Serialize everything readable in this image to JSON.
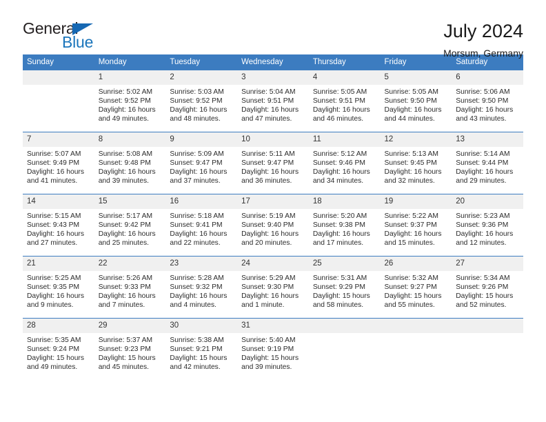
{
  "brand": {
    "name_top": "General",
    "name_bottom": "Blue",
    "accent_color": "#1b75bb",
    "triangle_color": "#1668b3"
  },
  "header": {
    "title": "July 2024",
    "subtitle": "Morsum, Germany"
  },
  "theme": {
    "header_blue": "#3c7cc0",
    "daynum_stripe": "#f0f0f0",
    "text_color": "#2b2b2b"
  },
  "weekdays": [
    "Sunday",
    "Monday",
    "Tuesday",
    "Wednesday",
    "Thursday",
    "Friday",
    "Saturday"
  ],
  "labels": {
    "sunrise_prefix": "Sunrise:",
    "sunset_prefix": "Sunset:",
    "daylight_prefix": "Daylight:"
  },
  "weeks": [
    [
      {
        "day": "",
        "empty": true,
        "l1": "",
        "l2": "",
        "l3": "",
        "l4": ""
      },
      {
        "day": "1",
        "l1": "Sunrise: 5:02 AM",
        "l2": "Sunset: 9:52 PM",
        "l3": "Daylight: 16 hours",
        "l4": "and 49 minutes."
      },
      {
        "day": "2",
        "l1": "Sunrise: 5:03 AM",
        "l2": "Sunset: 9:52 PM",
        "l3": "Daylight: 16 hours",
        "l4": "and 48 minutes."
      },
      {
        "day": "3",
        "l1": "Sunrise: 5:04 AM",
        "l2": "Sunset: 9:51 PM",
        "l3": "Daylight: 16 hours",
        "l4": "and 47 minutes."
      },
      {
        "day": "4",
        "l1": "Sunrise: 5:05 AM",
        "l2": "Sunset: 9:51 PM",
        "l3": "Daylight: 16 hours",
        "l4": "and 46 minutes."
      },
      {
        "day": "5",
        "l1": "Sunrise: 5:05 AM",
        "l2": "Sunset: 9:50 PM",
        "l3": "Daylight: 16 hours",
        "l4": "and 44 minutes."
      },
      {
        "day": "6",
        "l1": "Sunrise: 5:06 AM",
        "l2": "Sunset: 9:50 PM",
        "l3": "Daylight: 16 hours",
        "l4": "and 43 minutes."
      }
    ],
    [
      {
        "day": "7",
        "l1": "Sunrise: 5:07 AM",
        "l2": "Sunset: 9:49 PM",
        "l3": "Daylight: 16 hours",
        "l4": "and 41 minutes."
      },
      {
        "day": "8",
        "l1": "Sunrise: 5:08 AM",
        "l2": "Sunset: 9:48 PM",
        "l3": "Daylight: 16 hours",
        "l4": "and 39 minutes."
      },
      {
        "day": "9",
        "l1": "Sunrise: 5:09 AM",
        "l2": "Sunset: 9:47 PM",
        "l3": "Daylight: 16 hours",
        "l4": "and 37 minutes."
      },
      {
        "day": "10",
        "l1": "Sunrise: 5:11 AM",
        "l2": "Sunset: 9:47 PM",
        "l3": "Daylight: 16 hours",
        "l4": "and 36 minutes."
      },
      {
        "day": "11",
        "l1": "Sunrise: 5:12 AM",
        "l2": "Sunset: 9:46 PM",
        "l3": "Daylight: 16 hours",
        "l4": "and 34 minutes."
      },
      {
        "day": "12",
        "l1": "Sunrise: 5:13 AM",
        "l2": "Sunset: 9:45 PM",
        "l3": "Daylight: 16 hours",
        "l4": "and 32 minutes."
      },
      {
        "day": "13",
        "l1": "Sunrise: 5:14 AM",
        "l2": "Sunset: 9:44 PM",
        "l3": "Daylight: 16 hours",
        "l4": "and 29 minutes."
      }
    ],
    [
      {
        "day": "14",
        "l1": "Sunrise: 5:15 AM",
        "l2": "Sunset: 9:43 PM",
        "l3": "Daylight: 16 hours",
        "l4": "and 27 minutes."
      },
      {
        "day": "15",
        "l1": "Sunrise: 5:17 AM",
        "l2": "Sunset: 9:42 PM",
        "l3": "Daylight: 16 hours",
        "l4": "and 25 minutes."
      },
      {
        "day": "16",
        "l1": "Sunrise: 5:18 AM",
        "l2": "Sunset: 9:41 PM",
        "l3": "Daylight: 16 hours",
        "l4": "and 22 minutes."
      },
      {
        "day": "17",
        "l1": "Sunrise: 5:19 AM",
        "l2": "Sunset: 9:40 PM",
        "l3": "Daylight: 16 hours",
        "l4": "and 20 minutes."
      },
      {
        "day": "18",
        "l1": "Sunrise: 5:20 AM",
        "l2": "Sunset: 9:38 PM",
        "l3": "Daylight: 16 hours",
        "l4": "and 17 minutes."
      },
      {
        "day": "19",
        "l1": "Sunrise: 5:22 AM",
        "l2": "Sunset: 9:37 PM",
        "l3": "Daylight: 16 hours",
        "l4": "and 15 minutes."
      },
      {
        "day": "20",
        "l1": "Sunrise: 5:23 AM",
        "l2": "Sunset: 9:36 PM",
        "l3": "Daylight: 16 hours",
        "l4": "and 12 minutes."
      }
    ],
    [
      {
        "day": "21",
        "l1": "Sunrise: 5:25 AM",
        "l2": "Sunset: 9:35 PM",
        "l3": "Daylight: 16 hours",
        "l4": "and 9 minutes."
      },
      {
        "day": "22",
        "l1": "Sunrise: 5:26 AM",
        "l2": "Sunset: 9:33 PM",
        "l3": "Daylight: 16 hours",
        "l4": "and 7 minutes."
      },
      {
        "day": "23",
        "l1": "Sunrise: 5:28 AM",
        "l2": "Sunset: 9:32 PM",
        "l3": "Daylight: 16 hours",
        "l4": "and 4 minutes."
      },
      {
        "day": "24",
        "l1": "Sunrise: 5:29 AM",
        "l2": "Sunset: 9:30 PM",
        "l3": "Daylight: 16 hours",
        "l4": "and 1 minute."
      },
      {
        "day": "25",
        "l1": "Sunrise: 5:31 AM",
        "l2": "Sunset: 9:29 PM",
        "l3": "Daylight: 15 hours",
        "l4": "and 58 minutes."
      },
      {
        "day": "26",
        "l1": "Sunrise: 5:32 AM",
        "l2": "Sunset: 9:27 PM",
        "l3": "Daylight: 15 hours",
        "l4": "and 55 minutes."
      },
      {
        "day": "27",
        "l1": "Sunrise: 5:34 AM",
        "l2": "Sunset: 9:26 PM",
        "l3": "Daylight: 15 hours",
        "l4": "and 52 minutes."
      }
    ],
    [
      {
        "day": "28",
        "l1": "Sunrise: 5:35 AM",
        "l2": "Sunset: 9:24 PM",
        "l3": "Daylight: 15 hours",
        "l4": "and 49 minutes."
      },
      {
        "day": "29",
        "l1": "Sunrise: 5:37 AM",
        "l2": "Sunset: 9:23 PM",
        "l3": "Daylight: 15 hours",
        "l4": "and 45 minutes."
      },
      {
        "day": "30",
        "l1": "Sunrise: 5:38 AM",
        "l2": "Sunset: 9:21 PM",
        "l3": "Daylight: 15 hours",
        "l4": "and 42 minutes."
      },
      {
        "day": "31",
        "l1": "Sunrise: 5:40 AM",
        "l2": "Sunset: 9:19 PM",
        "l3": "Daylight: 15 hours",
        "l4": "and 39 minutes."
      },
      {
        "day": "",
        "empty": true,
        "l1": "",
        "l2": "",
        "l3": "",
        "l4": ""
      },
      {
        "day": "",
        "empty": true,
        "l1": "",
        "l2": "",
        "l3": "",
        "l4": ""
      },
      {
        "day": "",
        "empty": true,
        "l1": "",
        "l2": "",
        "l3": "",
        "l4": ""
      }
    ]
  ]
}
